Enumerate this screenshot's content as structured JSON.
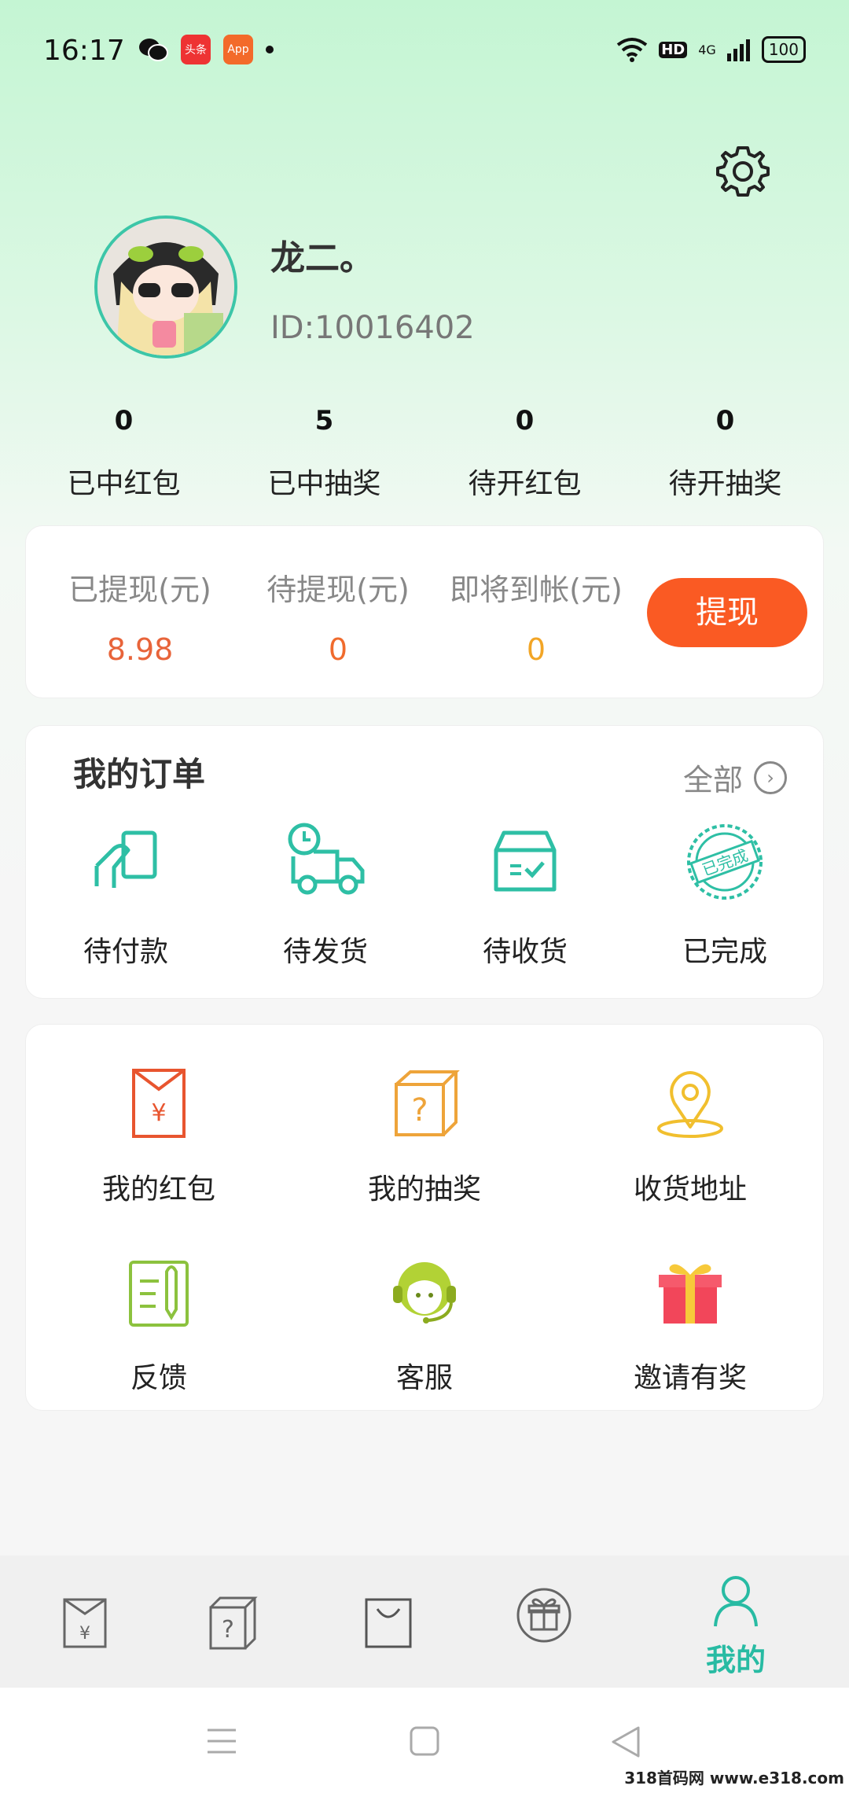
{
  "status_bar": {
    "time": "16:17",
    "app1": "头条",
    "app2": "App",
    "hd": "HD",
    "network": "4G",
    "battery": "100"
  },
  "profile": {
    "username": "龙二。",
    "id": "ID:10016402"
  },
  "stats": [
    {
      "value": "0",
      "label": "已中红包"
    },
    {
      "value": "5",
      "label": "已中抽奖"
    },
    {
      "value": "0",
      "label": "待开红包"
    },
    {
      "value": "0",
      "label": "待开抽奖"
    }
  ],
  "wallet": {
    "withdrawn_label": "已提现(元)",
    "withdrawn_value": "8.98",
    "pending_label": "待提现(元)",
    "pending_value": "0",
    "arriving_label": "即将到帐(元)",
    "arriving_value": "0",
    "withdraw_button": "提现",
    "colors": {
      "withdrawn": "#e8643a",
      "pending": "#f06b2d",
      "arriving": "#f2a526",
      "button": "#fa5a23"
    }
  },
  "orders": {
    "title": "我的订单",
    "all_label": "全部",
    "items": [
      {
        "label": "待付款",
        "icon": "payment-icon"
      },
      {
        "label": "待发货",
        "icon": "delivery-truck-icon"
      },
      {
        "label": "待收货",
        "icon": "receive-box-icon"
      },
      {
        "label": "已完成",
        "icon": "completed-stamp-icon",
        "stamp_text": "已完成"
      }
    ]
  },
  "services": [
    {
      "label": "我的红包",
      "icon": "red-envelope-icon"
    },
    {
      "label": "我的抽奖",
      "icon": "mystery-box-icon"
    },
    {
      "label": "收货地址",
      "icon": "location-pin-icon"
    },
    {
      "label": "反馈",
      "icon": "feedback-icon"
    },
    {
      "label": "客服",
      "icon": "customer-service-icon"
    },
    {
      "label": "邀请有奖",
      "icon": "gift-icon"
    }
  ],
  "bottom_nav": {
    "items": [
      {
        "icon": "red-envelope-tab-icon"
      },
      {
        "icon": "mystery-box-tab-icon"
      },
      {
        "icon": "shopping-bag-tab-icon"
      },
      {
        "icon": "gift-tab-icon"
      },
      {
        "icon": "user-tab-icon",
        "label": "我的",
        "active": true
      }
    ],
    "active_color": "#28bba3"
  },
  "watermark": "318首码网 www.e318.com"
}
